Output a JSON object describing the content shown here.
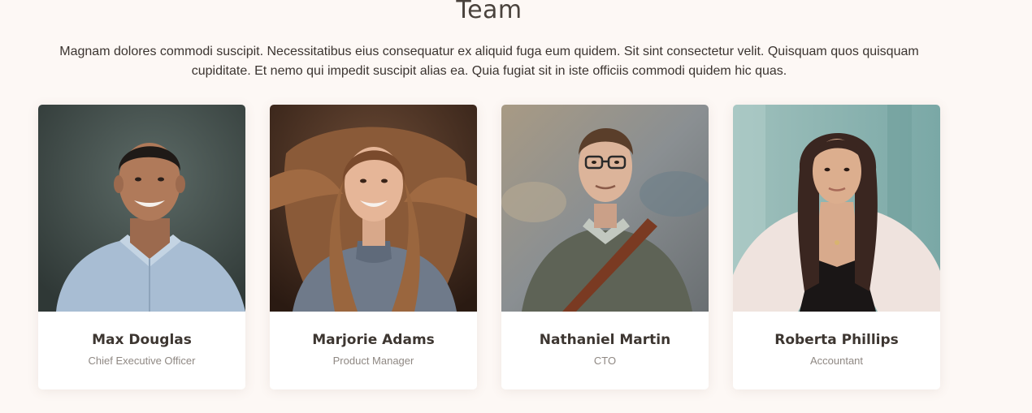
{
  "team_section": {
    "title": "Team",
    "description": "Magnam dolores commodi suscipit. Necessitatibus eius consequatur ex aliquid fuga eum quidem. Sit sint consectetur velit. Quisquam quos quisquam cupiditate. Et nemo qui impedit suscipit alias ea. Quia fugiat sit in iste officiis commodi quidem hic quas."
  },
  "members": [
    {
      "name": "Max Douglas",
      "role": "Chief Executive Officer"
    },
    {
      "name": "Marjorie Adams",
      "role": "Product Manager"
    },
    {
      "name": "Nathaniel Martin",
      "role": "CTO"
    },
    {
      "name": "Roberta Phillips",
      "role": "Accountant"
    }
  ],
  "colors": {
    "page_background": "#fdf8f5",
    "heading": "#4a433d",
    "body_text": "#3b3430",
    "role_text": "#8f8883",
    "card_background": "#ffffff"
  }
}
